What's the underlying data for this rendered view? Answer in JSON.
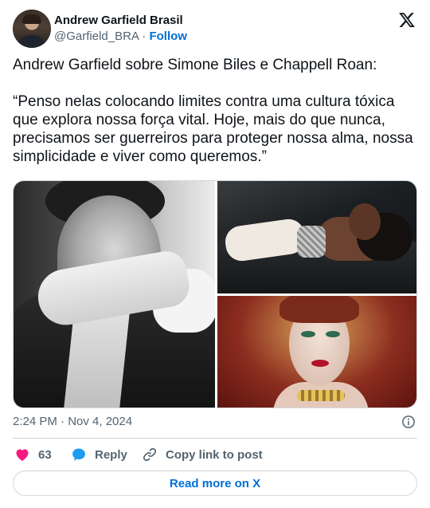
{
  "author": {
    "display_name": "Andrew Garfield Brasil",
    "handle": "@Garfield_BRA",
    "separator": "·",
    "follow_label": "Follow"
  },
  "tweet": {
    "text": "Andrew Garfield sobre Simone Biles e Chappell Roan:\n\n“Penso nelas colocando limites contra uma cultura tóxica que explora nossa força vital. Hoje, mais do que nunca, precisamos ser guerreiros para proteger nossa alma, nossa simplicidade e viver como queremos.”",
    "timestamp": "2:24 PM · Nov 4, 2024"
  },
  "media": {
    "count": 3
  },
  "actions": {
    "like_count": "63",
    "reply_label": "Reply",
    "copy_label": "Copy link to post"
  },
  "read_more_label": "Read more on X",
  "colors": {
    "like": "#f91880",
    "reply": "#1d9bf0",
    "link": "#006fd6",
    "muted": "#536471",
    "border": "#cfd9de"
  },
  "icons": [
    "x-logo-icon",
    "info-icon",
    "heart-icon",
    "reply-bubble-icon",
    "link-icon"
  ]
}
